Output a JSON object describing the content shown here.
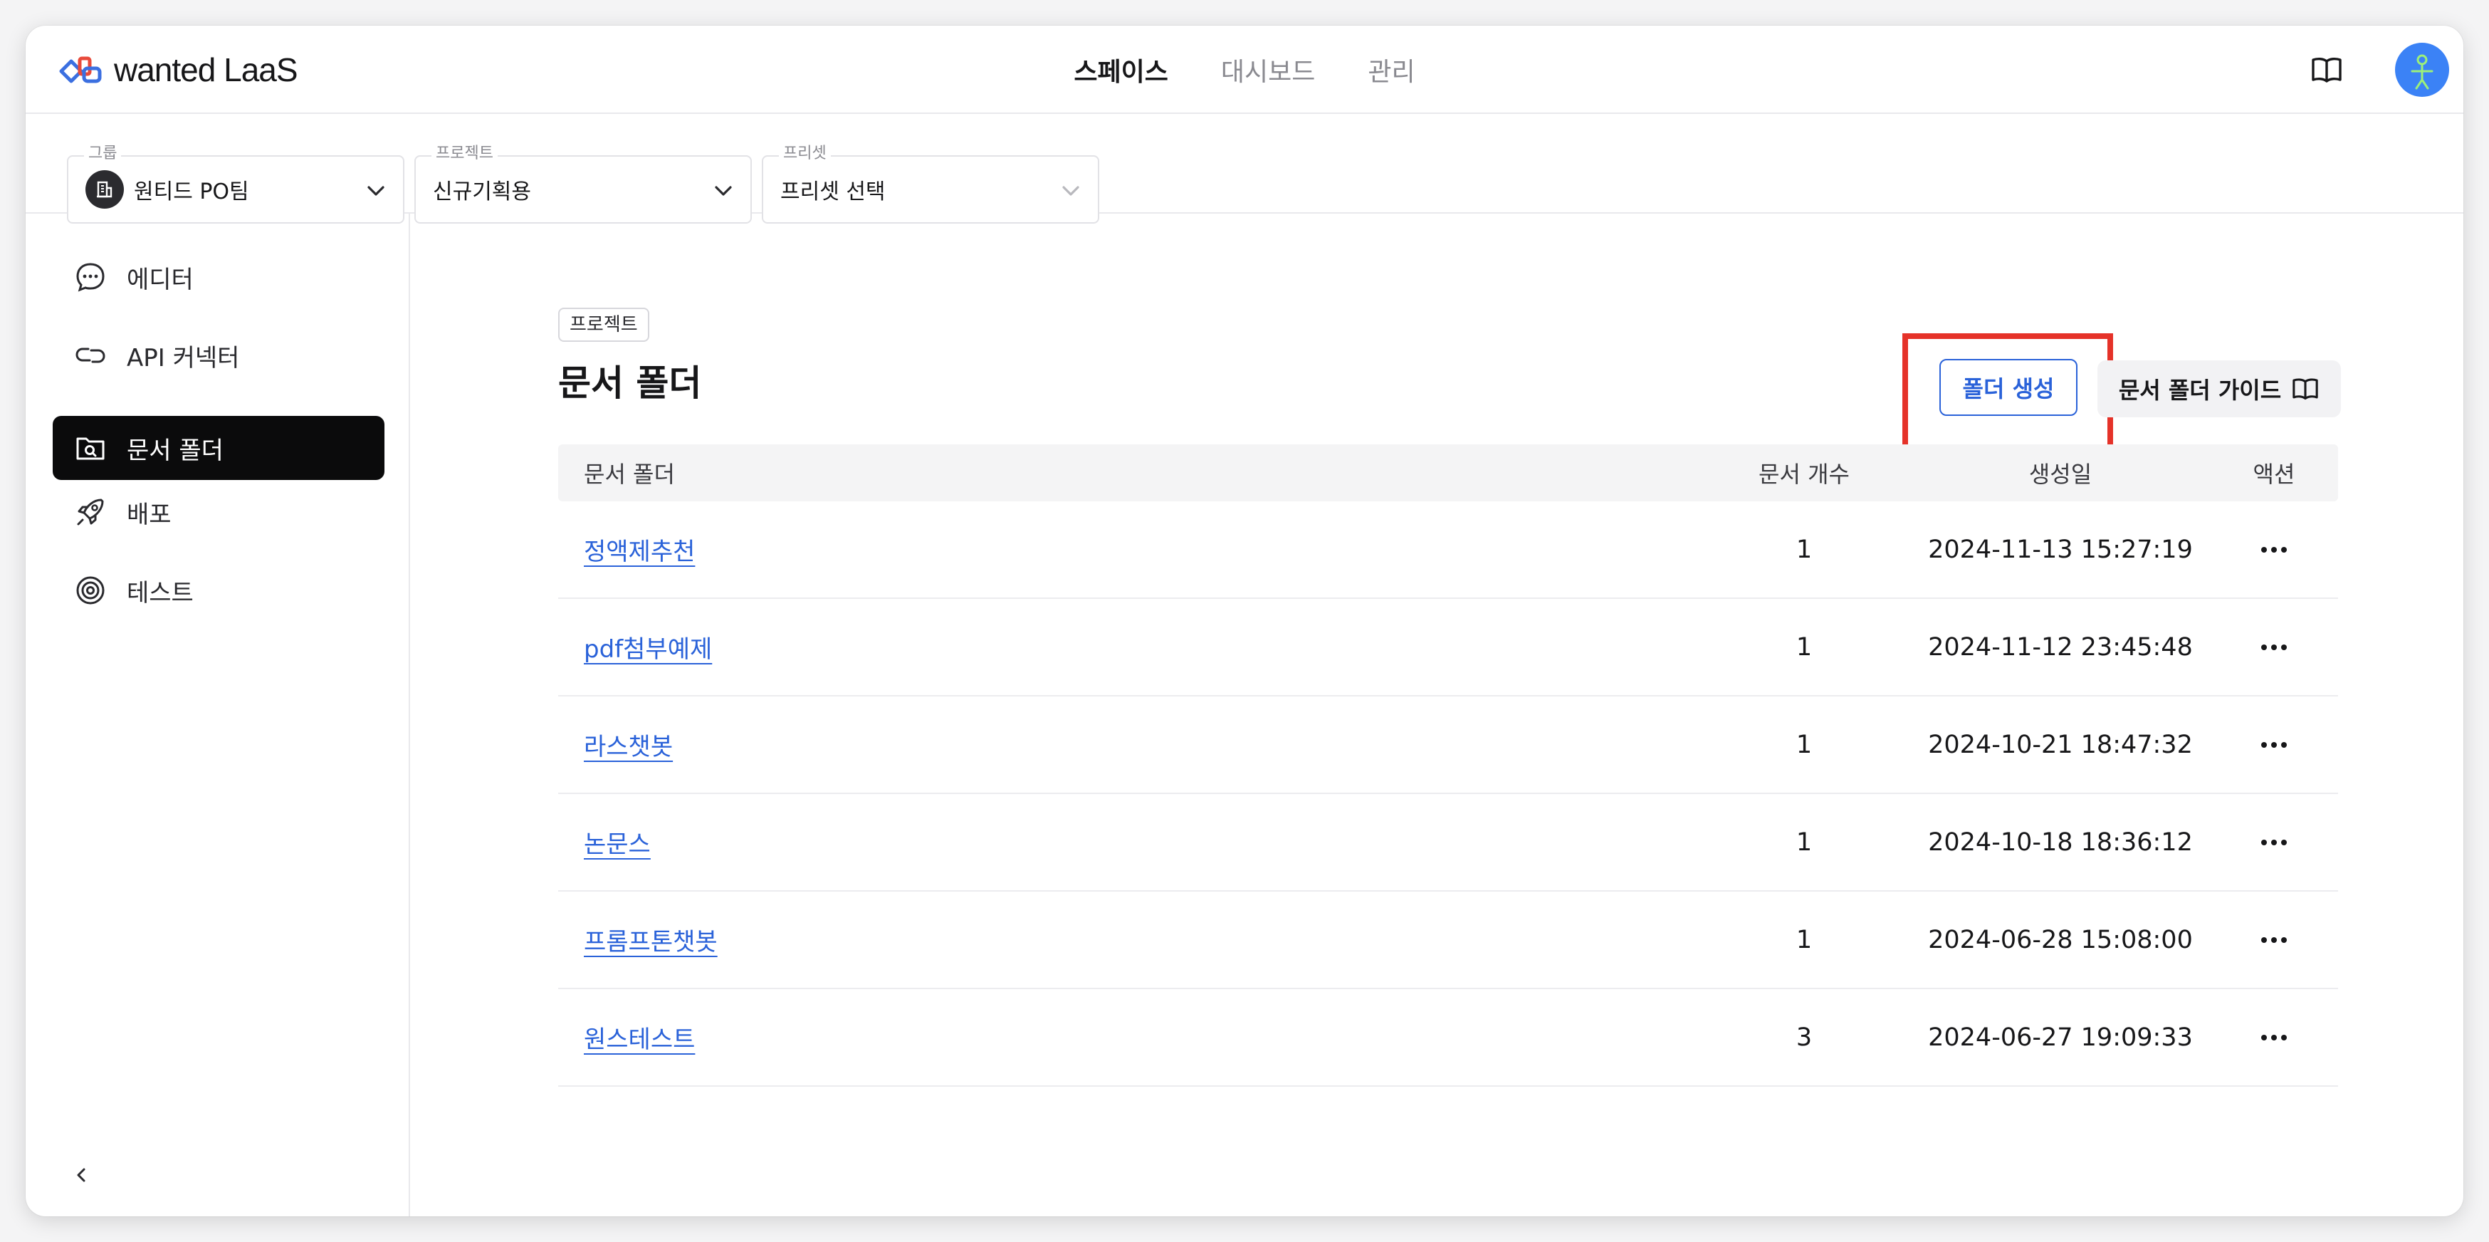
{
  "header": {
    "logo_text": "wanted LaaS",
    "nav": [
      {
        "label": "스페이스",
        "active": true
      },
      {
        "label": "대시보드",
        "active": false
      },
      {
        "label": "관리",
        "active": false
      }
    ],
    "avatar_color": "#3b82f6"
  },
  "selectors": {
    "group": {
      "label": "그룹",
      "value": "원티드 PO팀"
    },
    "project": {
      "label": "프로젝트",
      "value": "신규기획용"
    },
    "preset": {
      "label": "프리셋",
      "value": "프리셋 선택"
    }
  },
  "sidebar": {
    "items": [
      {
        "label": "에디터",
        "icon": "chat-bubble-icon",
        "active": false
      },
      {
        "label": "API 커넥터",
        "icon": "link-icon",
        "active": false
      },
      {
        "label": "문서 폴더",
        "icon": "folder-search-icon",
        "active": true
      },
      {
        "label": "배포",
        "icon": "rocket-icon",
        "active": false
      },
      {
        "label": "테스트",
        "icon": "target-icon",
        "active": false
      }
    ]
  },
  "main": {
    "badge": "프로젝트",
    "title": "문서 폴더",
    "create_button": "폴더 생성",
    "guide_button": "문서 폴더 가이드",
    "columns": [
      "문서 폴더",
      "문서 개수",
      "생성일",
      "액션"
    ],
    "rows": [
      {
        "name": "정액제추천",
        "count": "1",
        "created": "2024-11-13 15:27:19"
      },
      {
        "name": "pdf첨부예제",
        "count": "1",
        "created": "2024-11-12 23:45:48"
      },
      {
        "name": "라스챗봇",
        "count": "1",
        "created": "2024-10-21 18:47:32"
      },
      {
        "name": "논문스",
        "count": "1",
        "created": "2024-10-18 18:36:12"
      },
      {
        "name": "프롬프톤챗봇",
        "count": "1",
        "created": "2024-06-28 15:08:00"
      },
      {
        "name": "원스테스트",
        "count": "3",
        "created": "2024-06-27 19:09:33"
      }
    ]
  },
  "colors": {
    "accent": "#2a62d9",
    "highlight": "#e53229",
    "active_nav_bg": "#0b0b0c"
  }
}
